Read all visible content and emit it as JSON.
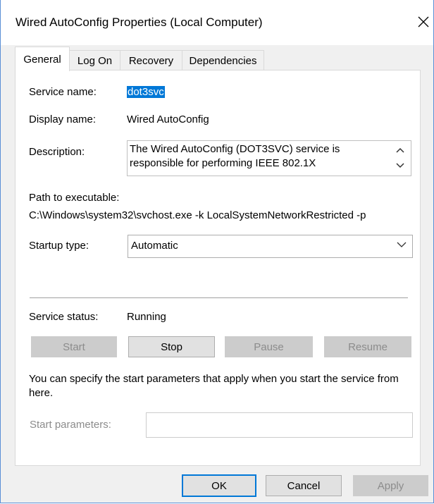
{
  "window": {
    "title": "Wired AutoConfig Properties (Local Computer)"
  },
  "tabs": [
    {
      "label": "General"
    },
    {
      "label": "Log On"
    },
    {
      "label": "Recovery"
    },
    {
      "label": "Dependencies"
    }
  ],
  "general": {
    "service_name_label": "Service name:",
    "service_name_value": "dot3svc",
    "display_name_label": "Display name:",
    "display_name_value": "Wired AutoConfig",
    "description_label": "Description:",
    "description_value": "The Wired AutoConfig (DOT3SVC) service is responsible for performing IEEE 802.1X",
    "path_label": "Path to executable:",
    "path_value": "C:\\Windows\\system32\\svchost.exe -k LocalSystemNetworkRestricted -p",
    "startup_type_label": "Startup type:",
    "startup_type_value": "Automatic",
    "service_status_label": "Service status:",
    "service_status_value": "Running",
    "buttons": {
      "start": "Start",
      "stop": "Stop",
      "pause": "Pause",
      "resume": "Resume"
    },
    "start_params_help": "You can specify the start parameters that apply when you start the service from here.",
    "start_params_label": "Start parameters:",
    "start_params_value": ""
  },
  "footer": {
    "ok": "OK",
    "cancel": "Cancel",
    "apply": "Apply"
  },
  "colors": {
    "accent": "#0078d7",
    "window_border": "#5a8fd6",
    "dialog_bg": "#f0f0f0",
    "disabled_text": "#8c8c8c"
  }
}
